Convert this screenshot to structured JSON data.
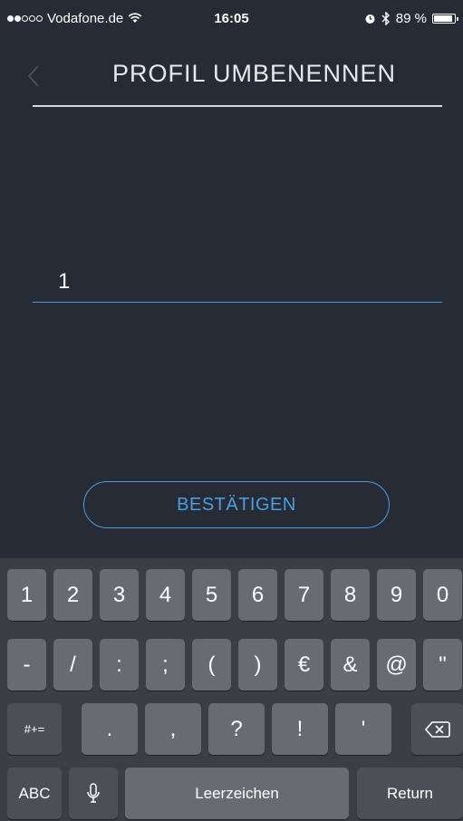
{
  "status_bar": {
    "carrier": "Vodafone.de",
    "time": "16:05",
    "battery": "89 %",
    "battery_level": 0.89
  },
  "header": {
    "title": "PROFIL UMBENENNEN"
  },
  "form": {
    "name_value": "1",
    "confirm_label": "BESTÄTIGEN"
  },
  "keyboard": {
    "row1": [
      "1",
      "2",
      "3",
      "4",
      "5",
      "6",
      "7",
      "8",
      "9",
      "0"
    ],
    "row2": [
      "-",
      "/",
      ":",
      ";",
      "(",
      ")",
      "€",
      "&",
      "@",
      "\""
    ],
    "row3": [
      ".",
      ",",
      "?",
      "!",
      "'"
    ],
    "mode_key": "#+=",
    "abc_key": "ABC",
    "space_key": "Leerzeichen",
    "return_key": "Return"
  }
}
